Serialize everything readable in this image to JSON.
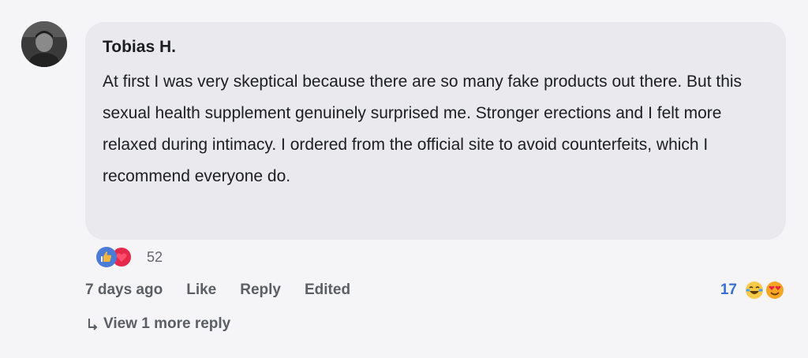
{
  "comment": {
    "author": "Tobias H.",
    "text": "At first I was very skeptical because there are so many fake products out there. But this sexual health supplement genuinely surprised me. Stronger erections and I felt more relaxed during intimacy. I ordered from the official site to avoid counterfeits, which I recommend everyone do.",
    "avatar_icon": "user-avatar-photo",
    "reactions": {
      "icons": [
        "like-icon",
        "love-icon"
      ],
      "count": "52",
      "like_color": "#4a7bd6",
      "love_color": "#e5294b"
    },
    "actions": {
      "time": "7 days ago",
      "like_label": "Like",
      "reply_label": "Reply",
      "edited_label": "Edited"
    },
    "reply_reactions": {
      "count": "17",
      "icons": [
        "laughing-emoji-icon",
        "heart-eyes-emoji-icon"
      ],
      "count_color": "#3b6fd8"
    },
    "more_replies": {
      "icon": "reply-arrow-icon",
      "label": "View 1 more reply"
    }
  }
}
